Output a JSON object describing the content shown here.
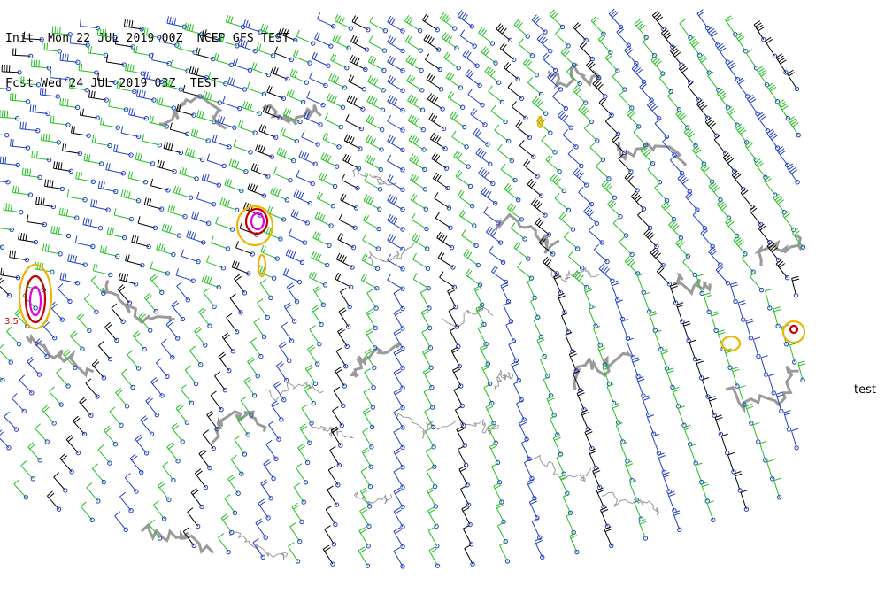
{
  "header": {
    "init_line": "Init  Mon 22 JUL 2019 00Z  NCEP GFS TEST",
    "fcst_line": "Fcst Wed 24 JUL 2019 03Z  TEST"
  },
  "side_label": "test",
  "contour_labels": [
    "3.5"
  ],
  "colors": {
    "barb_black": "#000000",
    "barb_blue": "#2040c8",
    "barb_green": "#20c020",
    "calm_circle": "#2040c8",
    "coastline": "#9a9a9a",
    "gray_contour": "#9a9a9a",
    "orange_contour": "#f0b400",
    "red_contour": "#c80000",
    "magenta_contour": "#e000e0"
  }
}
